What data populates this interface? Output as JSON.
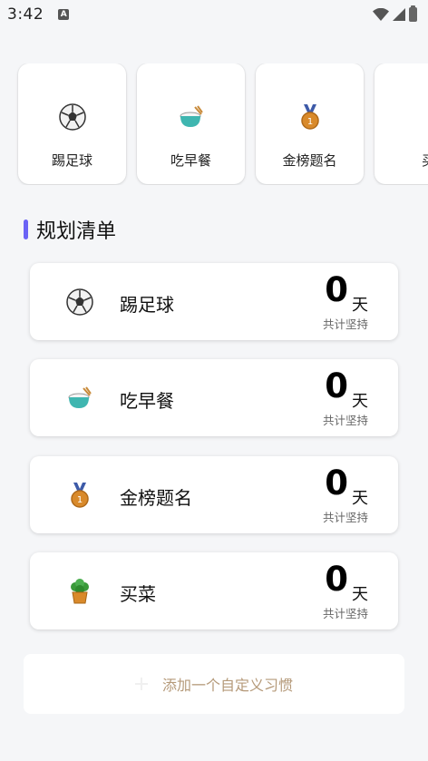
{
  "status_bar": {
    "time": "3:42",
    "notification_letter": "A"
  },
  "habit_cards": [
    {
      "label": "踢足球",
      "icon": "soccer-ball-icon"
    },
    {
      "label": "吃早餐",
      "icon": "rice-bowl-icon"
    },
    {
      "label": "金榜题名",
      "icon": "medal-icon"
    },
    {
      "label": "买",
      "icon": "plant-icon"
    }
  ],
  "section": {
    "title": "规划清单",
    "accent_color": "#6b63f5"
  },
  "plan_list": [
    {
      "label": "踢足球",
      "icon": "soccer-ball-icon",
      "days": "0",
      "unit": "天",
      "caption": "共计坚持"
    },
    {
      "label": "吃早餐",
      "icon": "rice-bowl-icon",
      "days": "0",
      "unit": "天",
      "caption": "共计坚持"
    },
    {
      "label": "金榜题名",
      "icon": "medal-icon",
      "days": "0",
      "unit": "天",
      "caption": "共计坚持"
    },
    {
      "label": "买菜",
      "icon": "potted-plant-icon",
      "days": "0",
      "unit": "天",
      "caption": "共计坚持"
    }
  ],
  "add_habit": {
    "label": "添加一个自定义习惯",
    "text_color": "#b59a7a"
  }
}
